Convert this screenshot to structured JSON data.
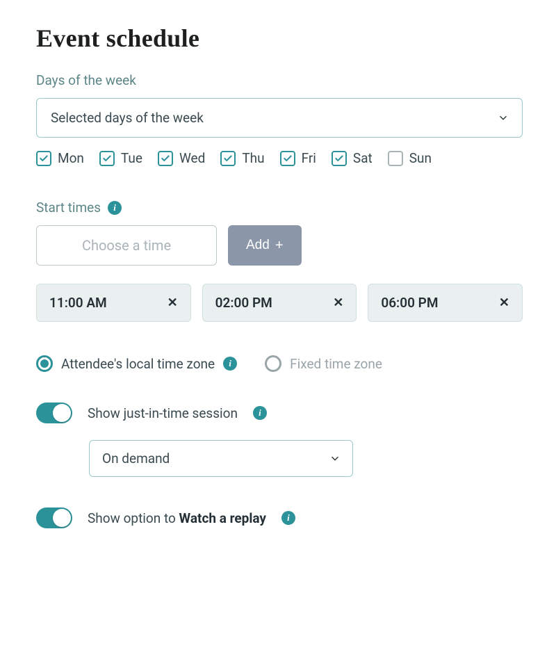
{
  "title": "Event schedule",
  "daysOfWeek": {
    "label": "Days of the week",
    "selectValue": "Selected days of the week",
    "items": [
      {
        "abbr": "Mon",
        "checked": true
      },
      {
        "abbr": "Tue",
        "checked": true
      },
      {
        "abbr": "Wed",
        "checked": true
      },
      {
        "abbr": "Thu",
        "checked": true
      },
      {
        "abbr": "Fri",
        "checked": true
      },
      {
        "abbr": "Sat",
        "checked": true
      },
      {
        "abbr": "Sun",
        "checked": false
      }
    ]
  },
  "startTimes": {
    "label": "Start times",
    "placeholder": "Choose a time",
    "addLabel": "Add",
    "times": [
      "11:00 AM",
      "02:00 PM",
      "06:00 PM"
    ]
  },
  "timezone": {
    "options": [
      {
        "label": "Attendee's local time zone",
        "selected": true,
        "info": true
      },
      {
        "label": "Fixed time zone",
        "selected": false,
        "info": false
      }
    ]
  },
  "jit": {
    "label": "Show just-in-time session",
    "enabled": true,
    "selectValue": "On demand"
  },
  "replay": {
    "labelPrefix": "Show option to ",
    "labelStrong": "Watch a replay",
    "enabled": true
  }
}
